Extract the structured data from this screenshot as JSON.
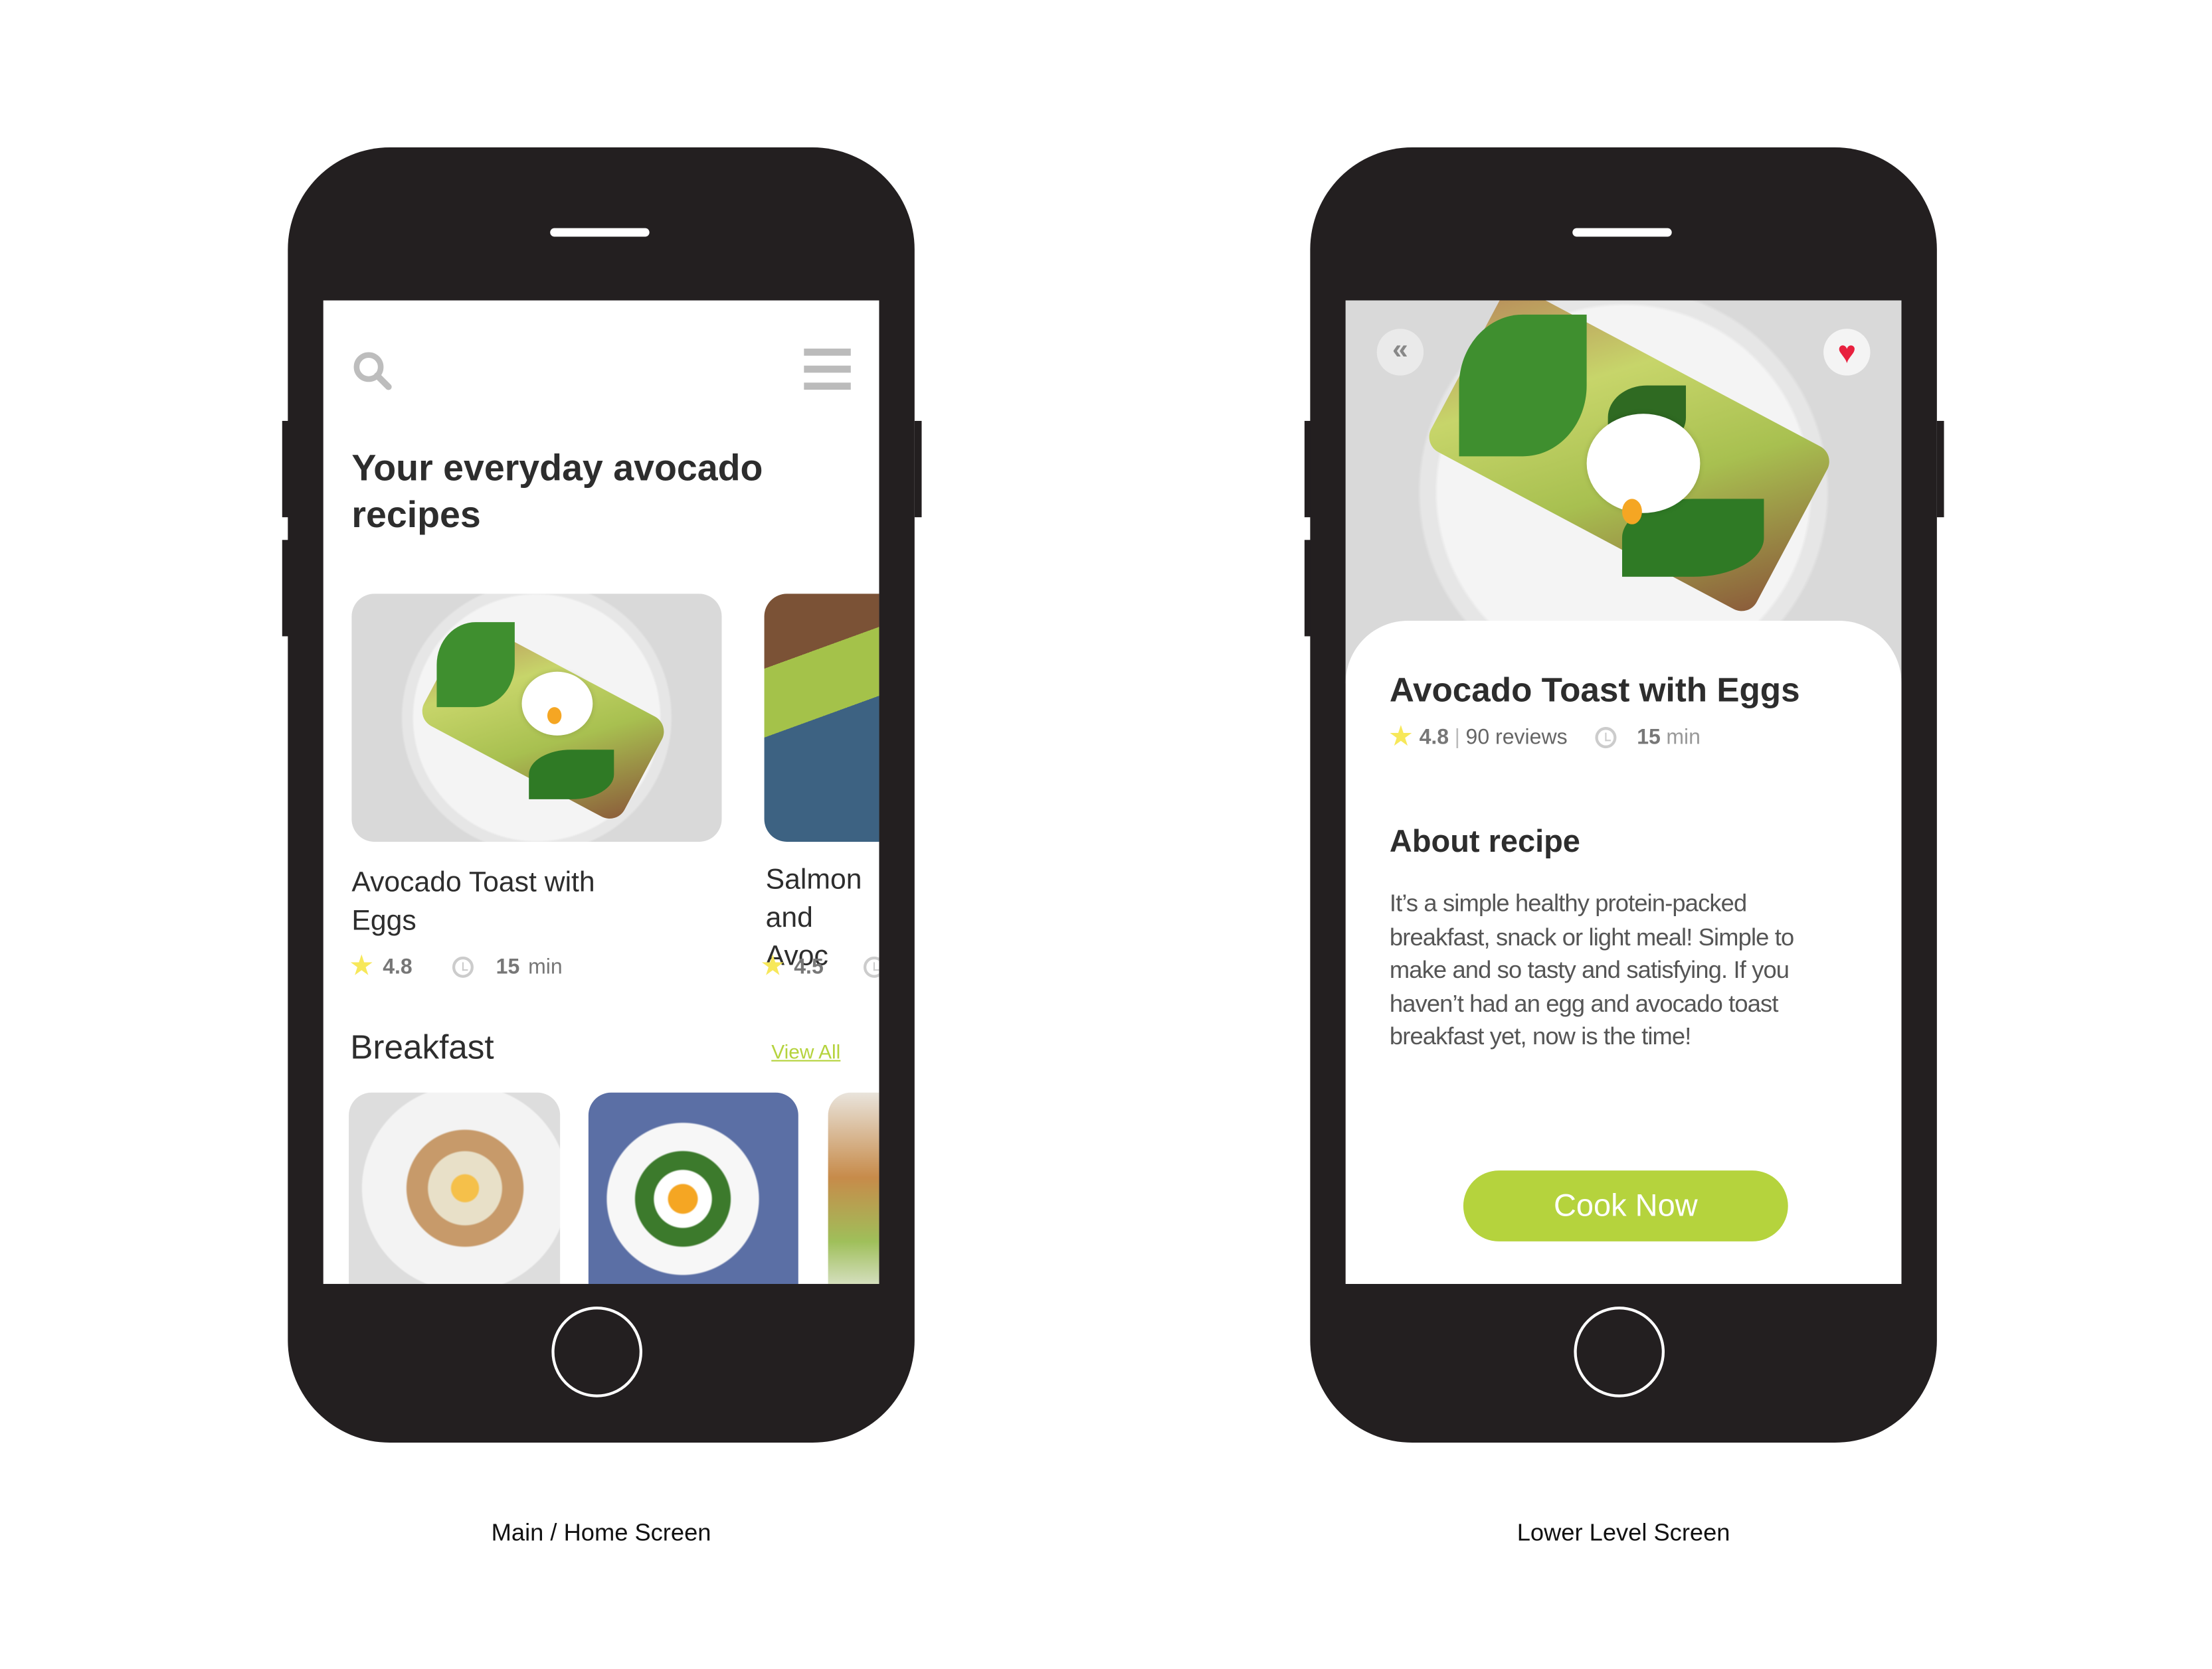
{
  "home_screen": {
    "caption": "Main / Home Screen",
    "icons": {
      "search": "search-icon",
      "menu": "hamburger-menu-icon"
    },
    "headline": "Your everyday avocado recipes",
    "featured": [
      {
        "title": "Avocado Toast with Eggs",
        "rating": "4.8",
        "time_value": "15",
        "time_unit": "min"
      },
      {
        "title": "Salmon and Avoc",
        "rating": "4.5"
      }
    ],
    "section": {
      "title": "Breakfast",
      "link": "View All"
    }
  },
  "detail_screen": {
    "caption": "Lower Level Screen",
    "icons": {
      "back": "double-chevron-left-icon",
      "favorite": "heart-icon"
    },
    "title": "Avocado Toast with Eggs",
    "rating": "4.8",
    "separator": "|",
    "reviews": "90 reviews",
    "time_value": "15",
    "time_unit": "min",
    "about_title": "About recipe",
    "about_text": "It’s a simple healthy protein-packed breakfast, snack or light meal! Simple to make and so tasty and satisfying. If you haven’t had an egg and avocado toast breakfast yet, now is the time!",
    "cta": "Cook Now"
  },
  "colors": {
    "accent": "#b5d33d",
    "phone": "#231f20",
    "star": "#f7e85a",
    "heart": "#e8203e",
    "text": "#2d2d2d"
  }
}
